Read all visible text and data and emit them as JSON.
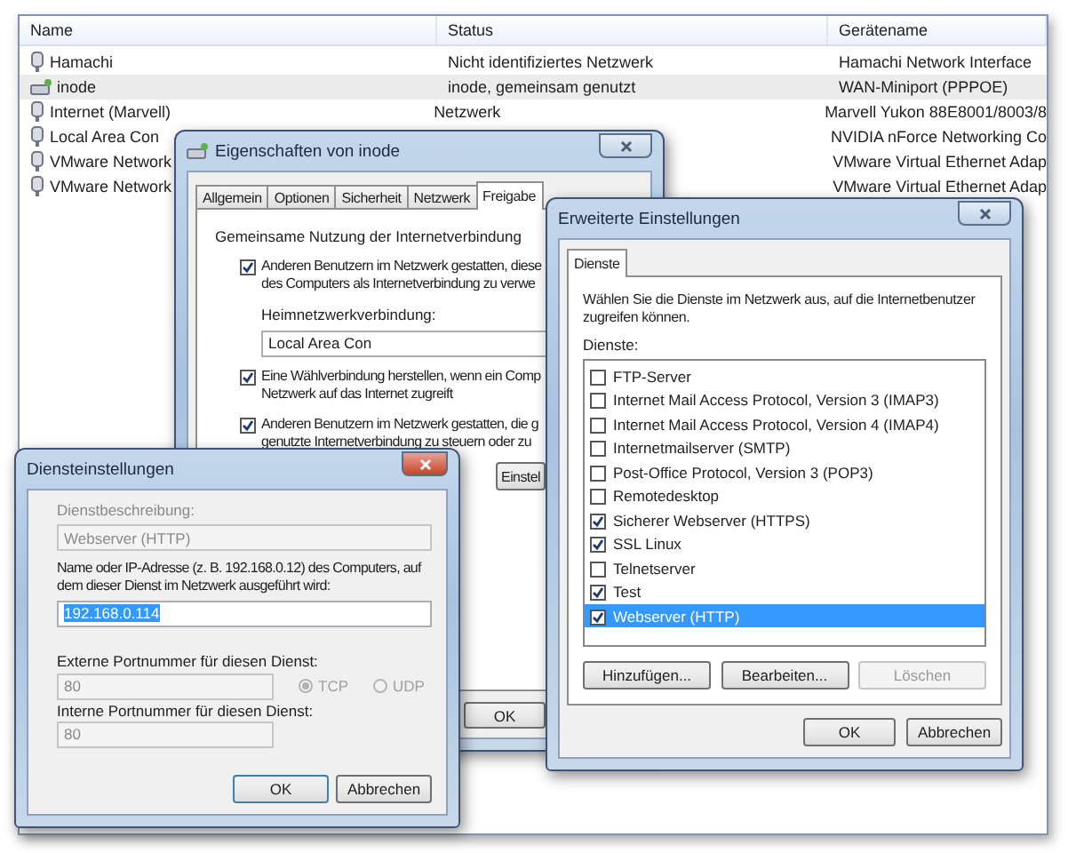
{
  "explorer": {
    "columns": [
      "Name",
      "Status",
      "Gerätename"
    ],
    "rows": [
      {
        "kind": "adapter",
        "name": "Hamachi",
        "status": "Nicht identifiziertes Netzwerk",
        "device": "Hamachi Network Interface",
        "selected": false
      },
      {
        "kind": "dialup",
        "name": "inode",
        "status": "inode, gemeinsam genutzt",
        "device": "WAN-Miniport (PPPOE)",
        "selected": true
      },
      {
        "kind": "adapter",
        "name": "Internet (Marvell)",
        "status": "Netzwerk",
        "device": "Marvell Yukon 88E8001/8003/8",
        "selected": false
      },
      {
        "kind": "adapter",
        "name": "Local Area Con",
        "device": "NVIDIA nForce Networking Co",
        "selected": false
      },
      {
        "kind": "adapter",
        "name": "VMware Network",
        "device": "VMware Virtual Ethernet Adap",
        "selected": false
      },
      {
        "kind": "adapter",
        "name": "VMware Network",
        "device": "VMware Virtual Ethernet Adap",
        "selected": false
      }
    ]
  },
  "properties": {
    "title": "Eigenschaften von inode",
    "tabs": [
      {
        "label": "Allgemein",
        "selected": false
      },
      {
        "label": "Optionen",
        "selected": false
      },
      {
        "label": "Sicherheit",
        "selected": false
      },
      {
        "label": "Netzwerk",
        "selected": false
      },
      {
        "label": "Freigabe",
        "selected": true
      }
    ],
    "group": "Gemeinsame Nutzung der Internetverbindung",
    "options": [
      {
        "checked": true,
        "lines": [
          "Anderen Benutzern im Netzwerk gestatten, diese",
          "des Computers als Internetverbindung zu verwe"
        ]
      },
      {
        "checked": true,
        "lines": [
          "Eine Wählverbindung herstellen, wenn ein Comp",
          "Netzwerk auf das Internet zugreift"
        ]
      },
      {
        "checked": true,
        "lines": [
          "Anderen Benutzern im Netzwerk gestatten, die g",
          "genutzte Internetverbindung zu steuern oder zu"
        ]
      }
    ],
    "home_label": "Heimnetzwerkverbindung:",
    "home_value": "Local Area Con",
    "settings_button": "Einstel",
    "ok_button": "OK"
  },
  "advanced": {
    "title": "Erweiterte Einstellungen",
    "tab": "Dienste",
    "description": "Wählen Sie die Dienste im Netzwerk aus, auf die Internetbenutzer zugreifen können.",
    "list_label": "Dienste:",
    "services": [
      {
        "label": "FTP-Server",
        "checked": false,
        "selected": false
      },
      {
        "label": "Internet Mail Access Protocol, Version 3 (IMAP3)",
        "checked": false,
        "selected": false
      },
      {
        "label": "Internet Mail Access Protocol, Version 4 (IMAP4)",
        "checked": false,
        "selected": false
      },
      {
        "label": "Internetmailserver (SMTP)",
        "checked": false,
        "selected": false
      },
      {
        "label": "Post-Office Protocol, Version 3 (POP3)",
        "checked": false,
        "selected": false
      },
      {
        "label": "Remotedesktop",
        "checked": false,
        "selected": false
      },
      {
        "label": "Sicherer Webserver (HTTPS)",
        "checked": true,
        "selected": false
      },
      {
        "label": "SSL Linux",
        "checked": true,
        "selected": false
      },
      {
        "label": "Telnetserver",
        "checked": false,
        "selected": false
      },
      {
        "label": "Test",
        "checked": true,
        "selected": false
      },
      {
        "label": "Webserver (HTTP)",
        "checked": true,
        "selected": true
      }
    ],
    "list_buttons": [
      {
        "label": "Hinzufügen...",
        "disabled": false
      },
      {
        "label": "Bearbeiten...",
        "disabled": false
      },
      {
        "label": "Löschen",
        "disabled": true
      }
    ],
    "buttons": [
      "OK",
      "Abbrechen"
    ]
  },
  "service": {
    "title": "Diensteinstellungen",
    "desc_label": "Dienstbeschreibung:",
    "desc_value": "Webserver (HTTP)",
    "desc_disabled": true,
    "host_label": "Name oder IP-Adresse (z. B. 192.168.0.12) des Computers, auf dem dieser Dienst im Netzwerk ausgeführt wird:",
    "host_value": "192.168.0.114",
    "ext_label": "Externe Portnummer für diesen Dienst:",
    "ext_value": "80",
    "ext_disabled": true,
    "protocols": [
      {
        "label": "TCP",
        "selected": true
      },
      {
        "label": "UDP",
        "selected": false
      }
    ],
    "int_label": "Interne Portnummer für diesen Dienst:",
    "int_value": "80",
    "int_disabled": true,
    "buttons": [
      "OK",
      "Abbrechen"
    ]
  }
}
